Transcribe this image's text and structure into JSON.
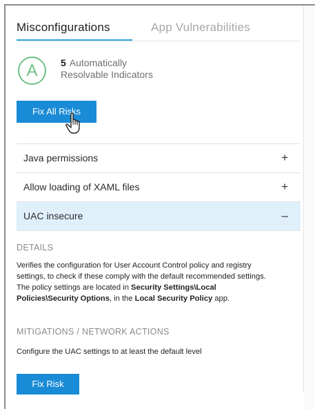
{
  "tabs": [
    {
      "label": "Misconfigurations",
      "active": true
    },
    {
      "label": "App Vulnerabilities",
      "active": false
    }
  ],
  "grade": {
    "letter": "A",
    "color": "#6dc187"
  },
  "resolvable": {
    "count": "5",
    "line1": "Automatically",
    "line2": "Resolvable Indicators"
  },
  "fix_all_button": "Fix All Risks",
  "accordion": [
    {
      "label": "Java permissions",
      "sign": "+",
      "expanded": false
    },
    {
      "label": "Allow loading of XAML files",
      "sign": "+",
      "expanded": false
    },
    {
      "label": "UAC insecure",
      "sign": "–",
      "expanded": true
    }
  ],
  "details": {
    "title": "DETAILS",
    "line1": "Verifies the configuration for User Account Control policy and registry",
    "line2": "settings, to check if these comply with the default recommended settings.",
    "line3_pre": "The policy settings are located in ",
    "line3_bold": "Security Settings\\Local",
    "line4_bold": "Policies\\Security Options",
    "line4_mid": ", in the ",
    "line4_bold2": "Local Security Policy",
    "line4_post": " app."
  },
  "mitigations": {
    "title": "MITIGATIONS / NETWORK ACTIONS",
    "text": "Configure the UAC settings to at least the default level"
  },
  "fix_risk_button": "Fix Risk",
  "colors": {
    "accent": "#1a8bd6",
    "tab_underline": "#2ea3e3",
    "expanded_bg": "#dff0fb"
  },
  "cursor_icon": "hand-pointer-icon"
}
